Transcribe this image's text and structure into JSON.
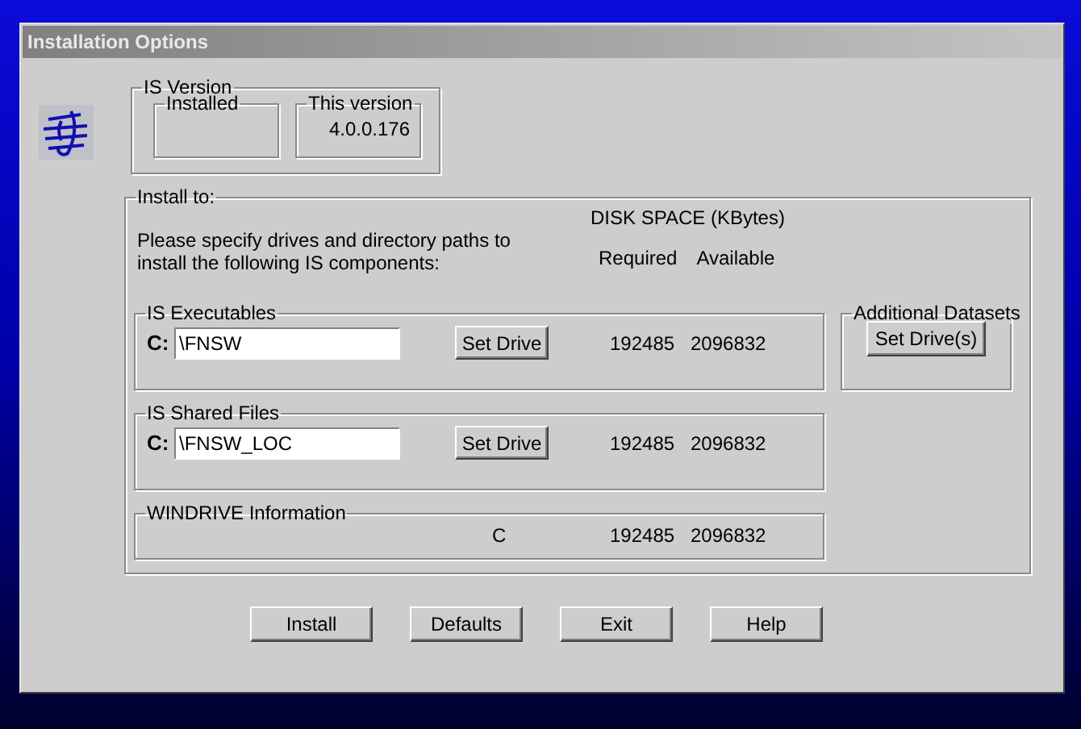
{
  "window": {
    "title": "Installation Options"
  },
  "is_version": {
    "label": "IS Version",
    "installed": {
      "label": "Installed"
    },
    "this_version": {
      "label": "This version",
      "value": "4.0.0.176"
    }
  },
  "install_to": {
    "label": "Install to:",
    "instructions": [
      "Please specify drives and directory paths to",
      "install the following IS components:"
    ],
    "disk_space_header": "DISK SPACE (KBytes)",
    "columns": [
      "Required",
      "Available"
    ],
    "components": [
      {
        "kind": "path",
        "label": "IS Executables",
        "drive": "C:",
        "path": "\\FNSW",
        "button": "Set Drive",
        "required": "192485",
        "available": "2096832"
      },
      {
        "kind": "path",
        "label": "IS Shared Files",
        "drive": "C:",
        "path": "\\FNSW_LOC",
        "button": "Set Drive",
        "required": "192485",
        "available": "2096832"
      },
      {
        "kind": "info",
        "label": "WINDRIVE Information",
        "drive": "C",
        "required": "192485",
        "available": "2096832"
      }
    ],
    "additional_datasets": {
      "label": "Additional Datasets",
      "button": "Set Drive(s)"
    }
  },
  "buttons": [
    "Install",
    "Defaults",
    "Exit",
    "Help"
  ]
}
